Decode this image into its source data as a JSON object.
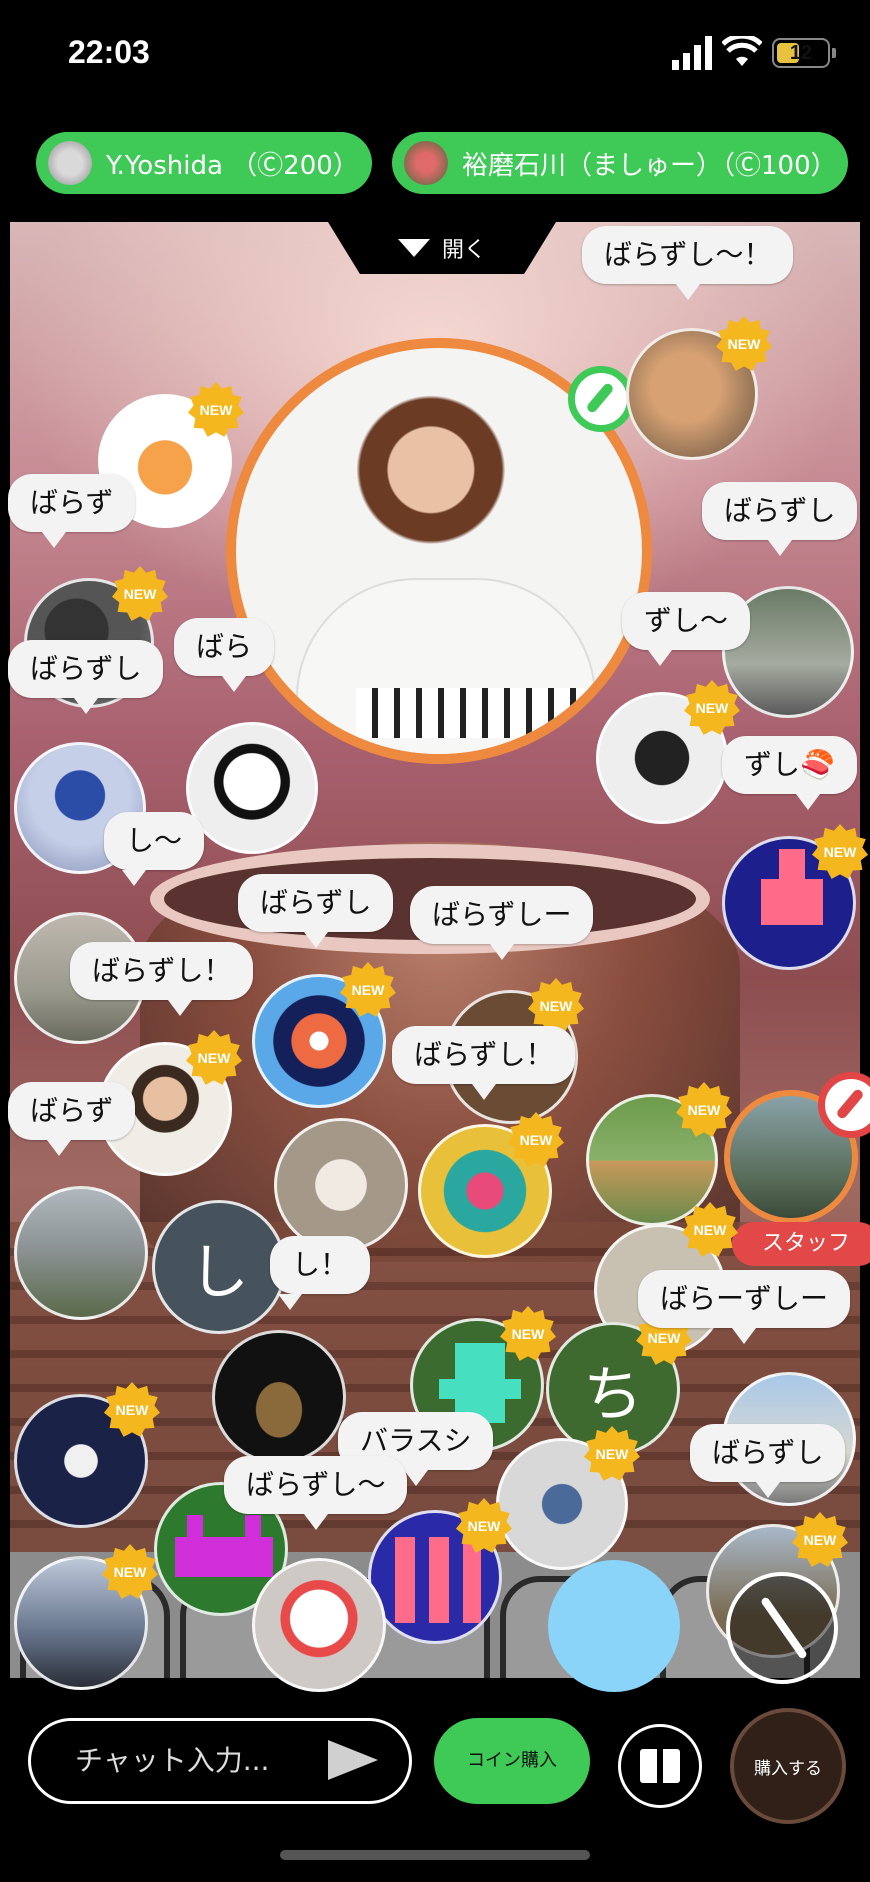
{
  "status_bar": {
    "time": "22:03",
    "battery": "12"
  },
  "hosts": [
    {
      "label": "Y.Yoshida （Ⓒ200）"
    },
    {
      "label": "裕磨石川（ましゅー）（Ⓒ100）"
    }
  ],
  "stage": {
    "open_label": "開く"
  },
  "new_badge": "NEW",
  "bubbles": [
    "ばらずし〜！",
    "ばらず",
    "ばらずし",
    "ずし〜",
    "ばら",
    "ばらずし",
    "ずし🍣",
    "し〜",
    "ばらずし",
    "ばらずしー",
    "ばらずし！",
    "ばらずし！",
    "ばらず",
    "し！",
    "ばらーずしー",
    "バラスシ",
    "ばらずし〜",
    "ばらずし"
  ],
  "avatars": {
    "letter_shi": "し",
    "letter_chi": "ち"
  },
  "staff_label": "スタッフ",
  "bottom": {
    "chat_placeholder": "チャット入力...",
    "coin_label": "コイン購入",
    "buy_label": "購入する"
  },
  "colors": {
    "accent_green": "#3fca57",
    "performer_ring": "#ee8a3f",
    "staff_red": "#e34848",
    "new_badge": "#f5b71e"
  }
}
